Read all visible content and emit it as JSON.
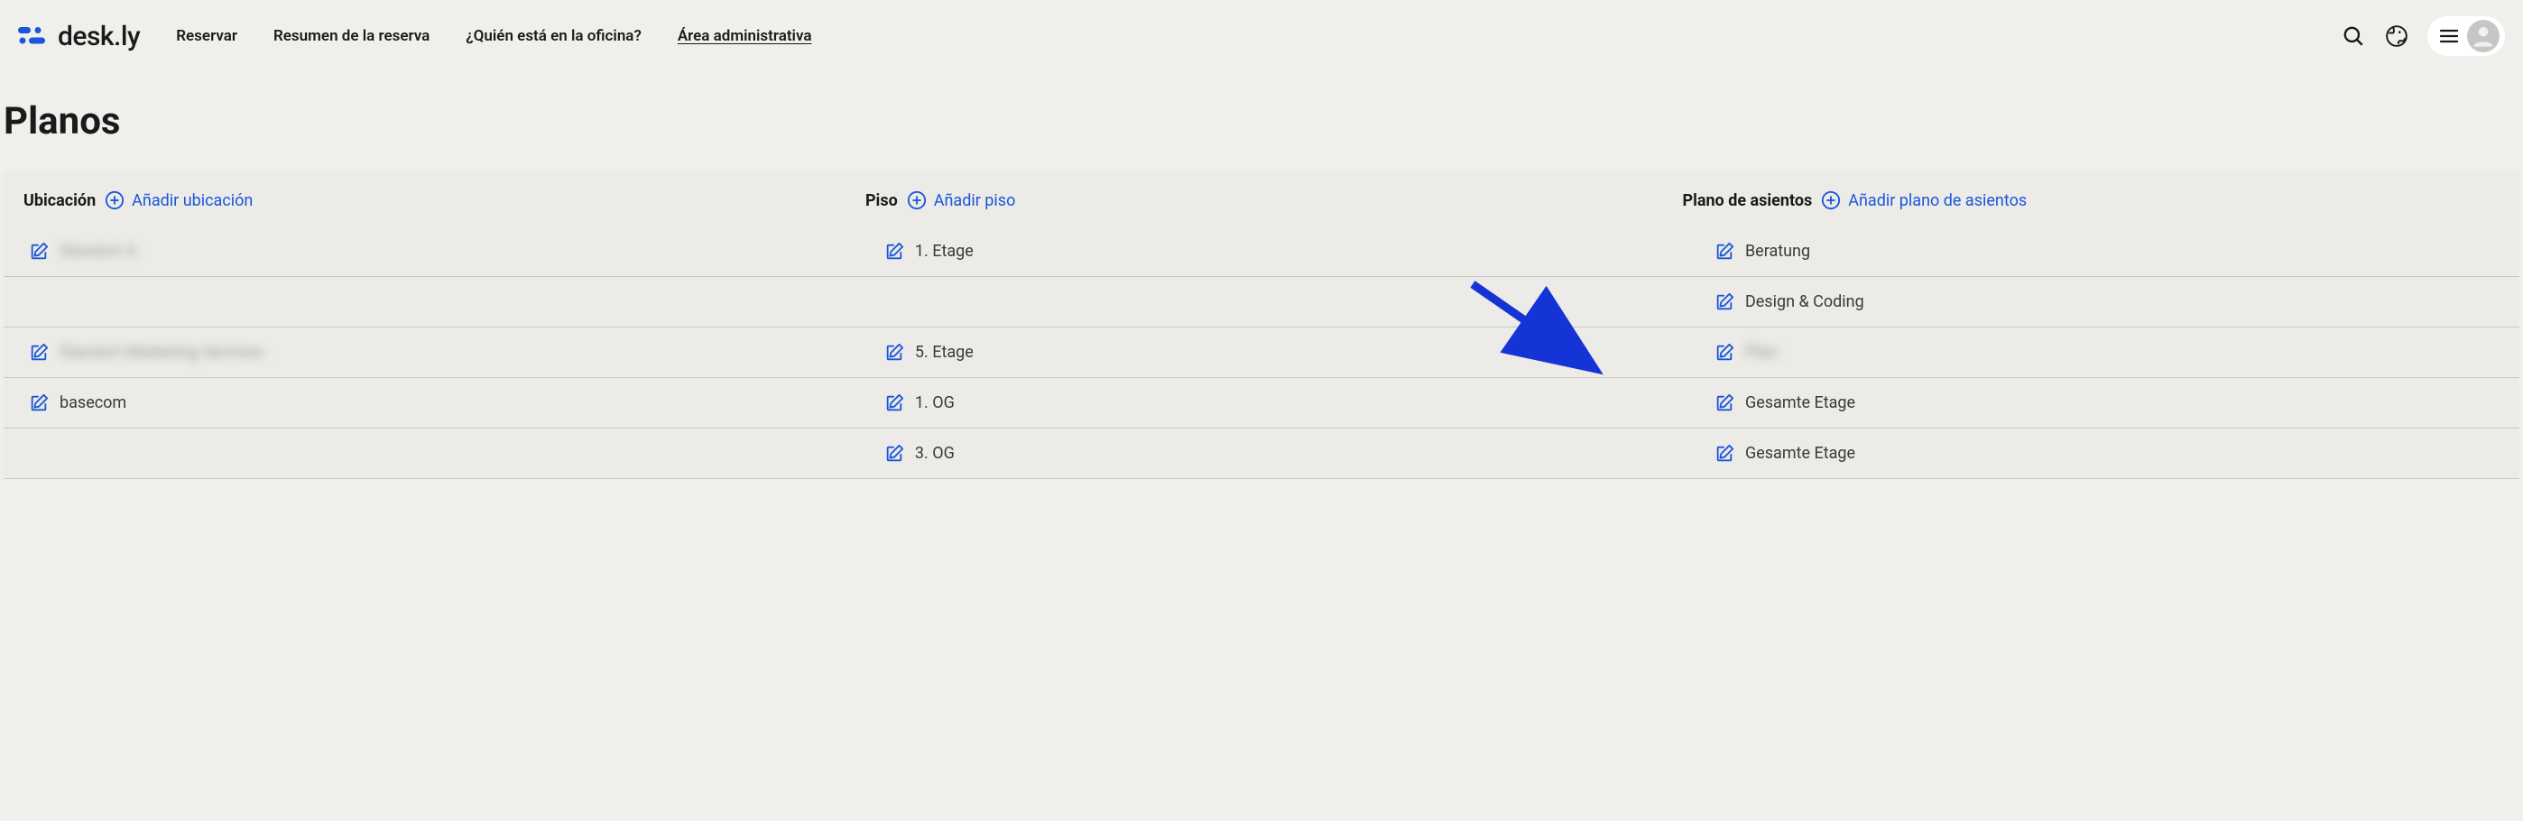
{
  "brand": {
    "name": "desk.ly"
  },
  "nav": {
    "items": [
      {
        "label": "Reservar",
        "active": false
      },
      {
        "label": "Resumen de la reserva",
        "active": false
      },
      {
        "label": "¿Quién está en la oficina?",
        "active": false
      },
      {
        "label": "Área administrativa",
        "active": true
      }
    ]
  },
  "page": {
    "title": "Planos"
  },
  "columns": {
    "location": {
      "label": "Ubicación",
      "add": "Añadir ubicación"
    },
    "floor": {
      "label": "Piso",
      "add": "Añadir piso"
    },
    "seatplan": {
      "label": "Plano de asientos",
      "add": "Añadir plano de asientos"
    }
  },
  "rows": [
    {
      "location": {
        "text": "Standort A",
        "blurred": true
      },
      "floors": [
        {
          "name": "1. Etage",
          "seatplans": [
            {
              "name": "Beratung",
              "blurred": false
            },
            {
              "name": "Design & Coding",
              "blurred": false
            }
          ]
        }
      ]
    },
    {
      "location": {
        "text": "Standort Marketing Services",
        "blurred": true
      },
      "floors": [
        {
          "name": "5. Etage",
          "seatplans": [
            {
              "name": "Plan",
              "blurred": true
            }
          ]
        }
      ]
    },
    {
      "location": {
        "text": "basecom",
        "blurred": false
      },
      "floors": [
        {
          "name": "1. OG",
          "seatplans": [
            {
              "name": "Gesamte Etage",
              "blurred": false
            }
          ]
        },
        {
          "name": "3. OG",
          "seatplans": [
            {
              "name": "Gesamte Etage",
              "blurred": false
            }
          ]
        }
      ]
    }
  ]
}
